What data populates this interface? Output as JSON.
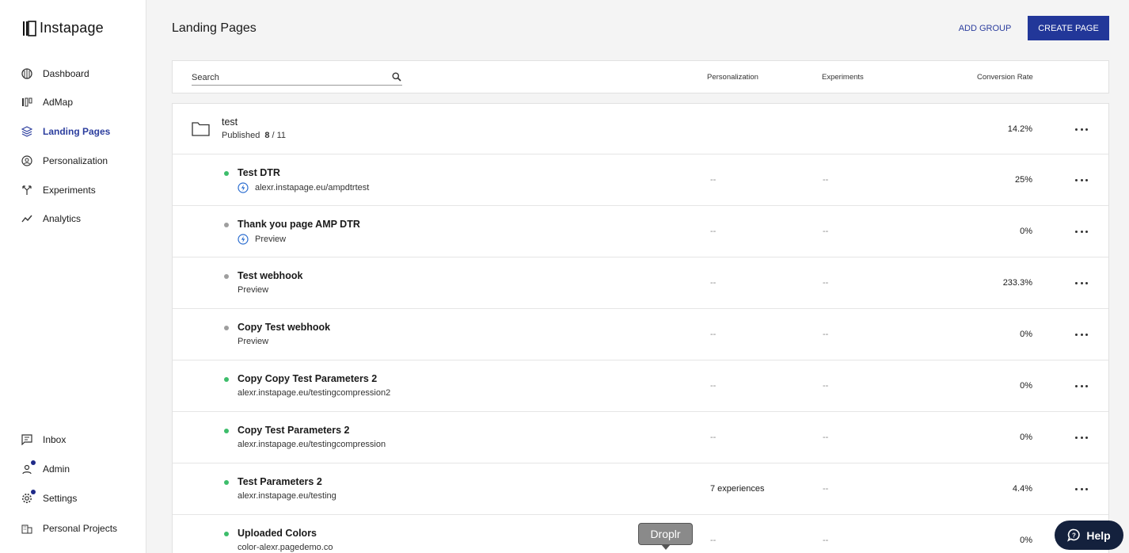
{
  "app": {
    "logo_text": "Instapage"
  },
  "sidebar": {
    "items": [
      {
        "label": "Dashboard",
        "icon": "dashboard-icon"
      },
      {
        "label": "AdMap",
        "icon": "admap-icon"
      },
      {
        "label": "Landing Pages",
        "icon": "layers-icon",
        "active": true
      },
      {
        "label": "Personalization",
        "icon": "person-circle-icon"
      },
      {
        "label": "Experiments",
        "icon": "split-icon"
      },
      {
        "label": "Analytics",
        "icon": "trend-icon"
      }
    ],
    "bottom_items": [
      {
        "label": "Inbox",
        "icon": "chat-icon"
      },
      {
        "label": "Admin",
        "icon": "user-icon",
        "badge": true
      },
      {
        "label": "Settings",
        "icon": "gear-icon",
        "badge": true
      },
      {
        "label": "Personal Projects",
        "icon": "building-icon"
      }
    ]
  },
  "header": {
    "title": "Landing Pages",
    "add_group": "ADD GROUP",
    "create_page": "CREATE PAGE"
  },
  "filter": {
    "search_placeholder": "Search",
    "columns": {
      "personalization": "Personalization",
      "experiments": "Experiments",
      "conversion": "Conversion Rate"
    }
  },
  "group": {
    "name": "test",
    "status_label": "Published",
    "count": "8",
    "total": "/ 11",
    "conversion": "14.2%"
  },
  "pages": [
    {
      "name": "Test DTR",
      "sub": "alexr.instapage.eu/ampdtrtest",
      "amp": true,
      "status": "published",
      "personalization": "--",
      "experiments": "--",
      "conversion": "25%"
    },
    {
      "name": "Thank you page AMP DTR",
      "sub": "Preview",
      "amp": true,
      "status": "draft",
      "personalization": "--",
      "experiments": "--",
      "conversion": "0%"
    },
    {
      "name": "Test webhook",
      "sub": "Preview",
      "amp": false,
      "status": "draft",
      "personalization": "--",
      "experiments": "--",
      "conversion": "233.3%"
    },
    {
      "name": "Copy Test webhook",
      "sub": "Preview",
      "amp": false,
      "status": "draft",
      "personalization": "--",
      "experiments": "--",
      "conversion": "0%"
    },
    {
      "name": "Copy Copy Test Parameters 2",
      "sub": "alexr.instapage.eu/testingcompression2",
      "amp": false,
      "status": "published",
      "personalization": "--",
      "experiments": "--",
      "conversion": "0%"
    },
    {
      "name": "Copy Test Parameters 2",
      "sub": "alexr.instapage.eu/testingcompression",
      "amp": false,
      "status": "published",
      "personalization": "--",
      "experiments": "--",
      "conversion": "0%"
    },
    {
      "name": "Test Parameters 2",
      "sub": "alexr.instapage.eu/testing",
      "amp": false,
      "status": "published",
      "personalization": "7 experiences",
      "experiments": "--",
      "conversion": "4.4%"
    },
    {
      "name": "Uploaded Colors",
      "sub": "color-alexr.pagedemo.co",
      "amp": false,
      "status": "published",
      "personalization": "--",
      "experiments": "--",
      "conversion": "0%"
    }
  ],
  "colors": {
    "accent": "#223799",
    "published": "#3dbd6b",
    "draft": "#9e9e9e"
  },
  "overlay": {
    "droplr": "Droplr",
    "help": "Help"
  }
}
